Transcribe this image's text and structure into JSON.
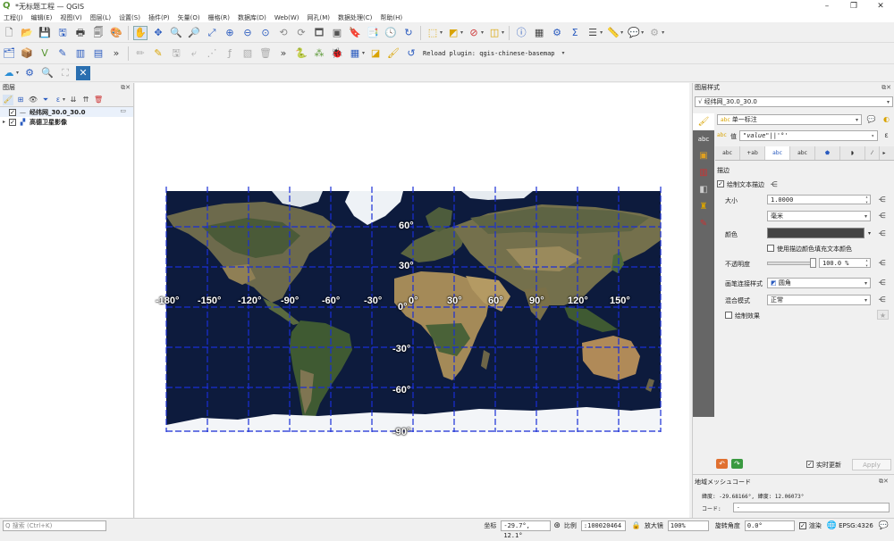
{
  "window": {
    "title": "*无标题工程 — QGIS",
    "logo": "Q",
    "controls": [
      "–",
      "❐",
      "✕"
    ]
  },
  "menu": [
    "工程(J)",
    "编辑(E)",
    "视图(V)",
    "图层(L)",
    "设置(S)",
    "插件(P)",
    "矢量(O)",
    "栅格(R)",
    "数据库(D)",
    "Web(W)",
    "网孔(M)",
    "数据处理(C)",
    "帮助(H)"
  ],
  "toolbar2": {
    "reload_label": "Reload plugin: qgis-chinese-basemap"
  },
  "layers_panel": {
    "title": "图层",
    "layers": [
      {
        "name": "经纬网_30.0_30.0",
        "checked": true,
        "icon": "line-icon"
      },
      {
        "name": "高德卫星影像",
        "checked": true,
        "icon": "raster-icon"
      }
    ]
  },
  "map": {
    "lon_labels": [
      "-180°",
      "-150°",
      "-120°",
      "-90°",
      "-60°",
      "-30°",
      "0°",
      "30°",
      "60°",
      "90°",
      "120°",
      "150°"
    ],
    "lat_labels": [
      "60°",
      "30°",
      "0°",
      "-30°",
      "-60°",
      "-90°"
    ],
    "grid_color": "#1a2fd6",
    "ocean_color": "#0d1b3d"
  },
  "style_dock": {
    "title": "图层样式",
    "layer_combo": "经纬网_30.0_30.0",
    "label_mode": "单一标注",
    "value_prefix": "值",
    "value_expr": "\"value\"||'°'",
    "section": "描边",
    "draw_buffer_label": "绘制文本描边",
    "draw_buffer_checked": true,
    "size_label": "大小",
    "size_value": "1.0000",
    "unit_value": "毫米",
    "color_label": "颜色",
    "fill_label": "使用描边颜色填充文本颜色",
    "opacity_label": "不透明度",
    "opacity_value": "100.0 %",
    "opacity": 1.0,
    "pen_join_label": "画笔连接样式",
    "pen_join_value": "圆角",
    "blend_label": "混合模式",
    "blend_value": "正常",
    "effects_label": "绘制效果",
    "live_update_label": "实时更新",
    "live_update_checked": true,
    "apply_label": "Apply"
  },
  "mesh_panel": {
    "title": "地域メッシュコード",
    "coords_text": "緯度: -29.68166°, 緯度: 12.06073°",
    "code_label": "コード:",
    "code_value": "-"
  },
  "statusbar": {
    "search_placeholder": "Q 搜索 (Ctrl+K)",
    "coord_label": "坐标",
    "coord_value": "-29.7°, 12.1°",
    "scale_label": "比例",
    "scale_value": ":100020464",
    "magnifier_label": "放大镜",
    "magnifier_value": "100%",
    "rotation_label": "旋转角度",
    "rotation_value": "0.0°",
    "render_label": "渲染",
    "crs_label": "EPSG:4326"
  }
}
